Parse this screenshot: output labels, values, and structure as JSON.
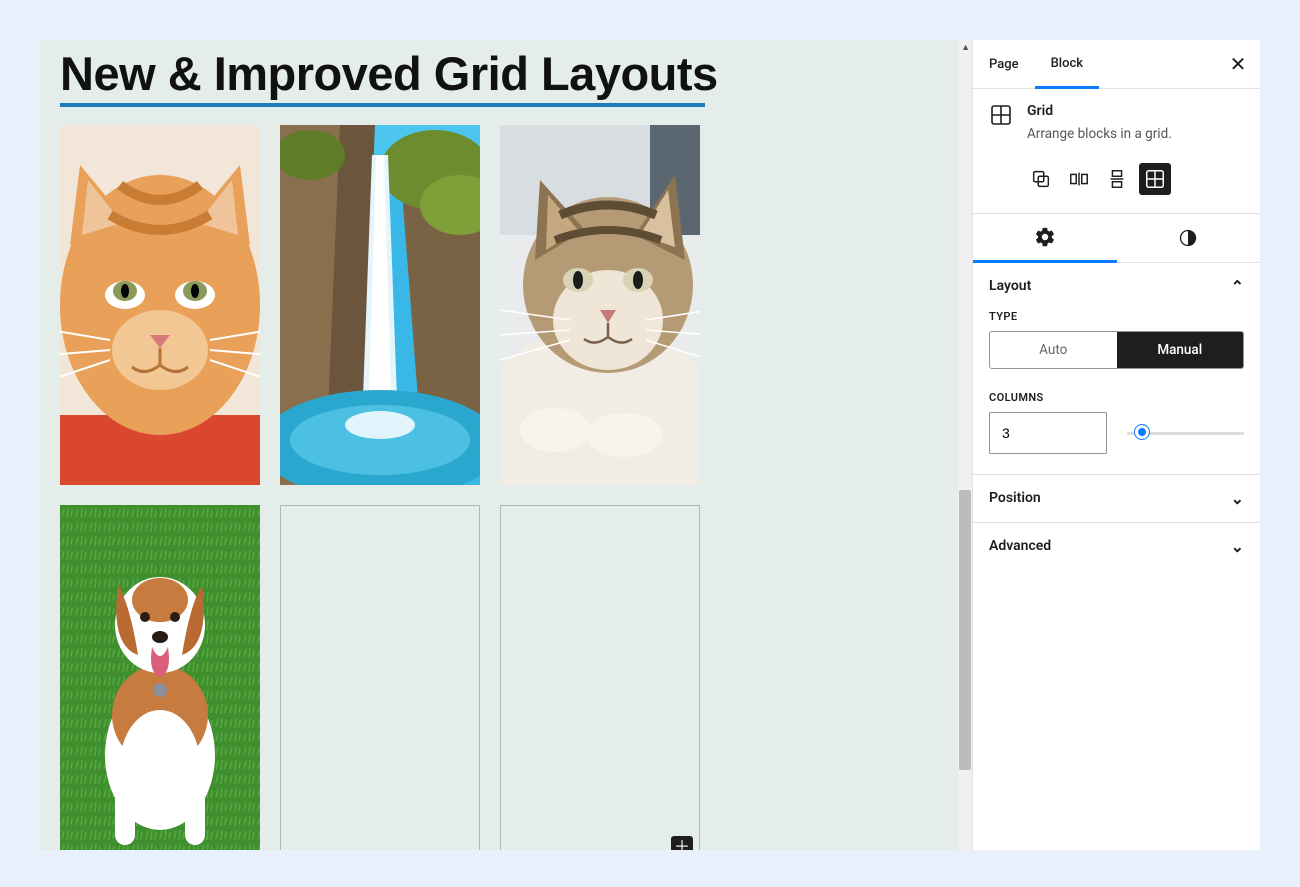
{
  "canvas": {
    "title": "New & Improved Grid Layouts",
    "grid_columns": 3,
    "cells": [
      {
        "kind": "image",
        "image": "orange-cat"
      },
      {
        "kind": "image",
        "image": "waterfall"
      },
      {
        "kind": "image",
        "image": "tabby-cat"
      },
      {
        "kind": "image",
        "image": "dog"
      },
      {
        "kind": "empty"
      },
      {
        "kind": "empty",
        "add_button": true
      }
    ]
  },
  "sidebar": {
    "tabs": {
      "page": "Page",
      "block": "Block",
      "active": "block"
    },
    "block": {
      "name": "Grid",
      "description": "Arrange blocks in a grid.",
      "transforms": [
        "group",
        "row",
        "stack",
        "grid"
      ],
      "transform_active": "grid"
    },
    "inspector_tabs": {
      "settings": "settings",
      "styles": "styles",
      "active": "settings"
    },
    "layout_panel": {
      "title": "Layout",
      "open": true,
      "type_label": "Type",
      "type_options": {
        "auto": "Auto",
        "manual": "Manual"
      },
      "type_active": "manual",
      "columns_label": "Columns",
      "columns_value": "3",
      "slider_min": 1,
      "slider_max": 12,
      "slider_value": 3
    },
    "position_panel": {
      "title": "Position",
      "open": false
    },
    "advanced_panel": {
      "title": "Advanced",
      "open": false
    }
  }
}
